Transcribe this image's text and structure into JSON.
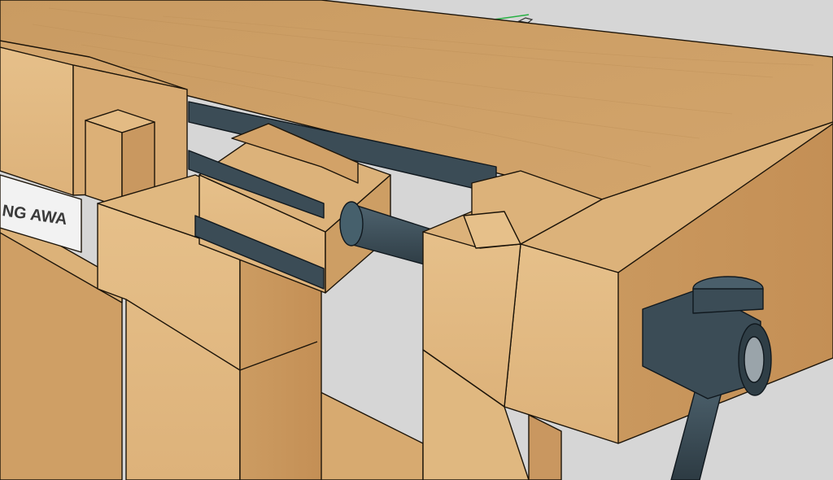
{
  "viewport": {
    "sign_text": "NG AWA",
    "colors": {
      "background": "#d6d6d6",
      "wood_light": "#e2bb84",
      "wood_mid": "#d6a96f",
      "wood_dark": "#c08a52",
      "hardware": "#3b4c56",
      "axis_green": "#26b043"
    },
    "icons": [
      "axis-line",
      "camera-cursor-icon"
    ]
  }
}
